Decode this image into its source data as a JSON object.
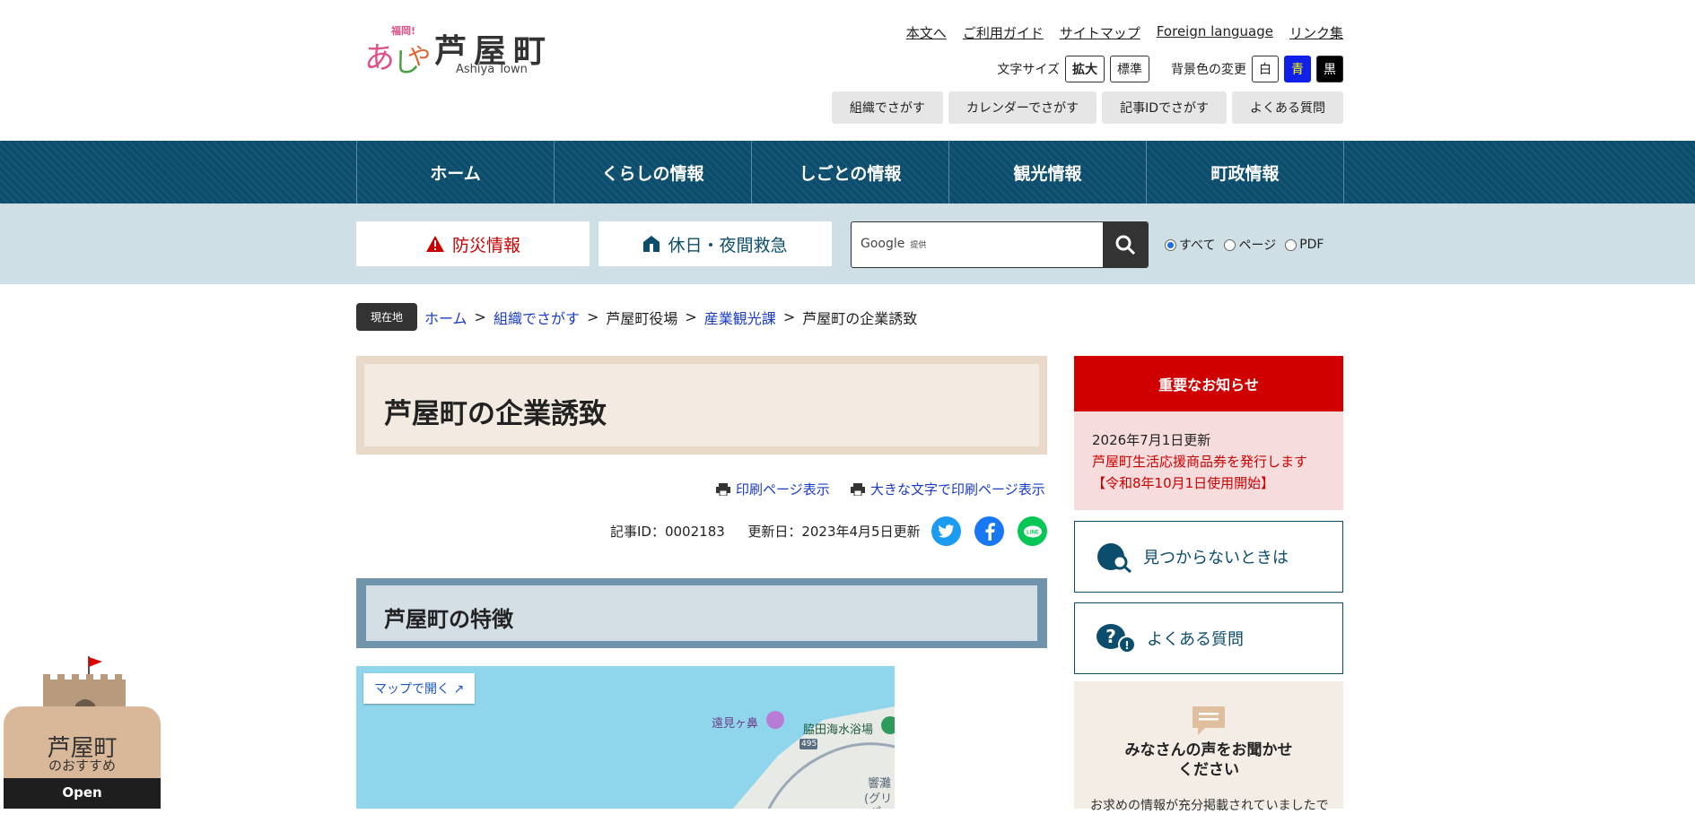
{
  "header": {
    "logo_name": "芦屋町",
    "logo_sub": "Ashiya Town",
    "logo_mark": "あしや",
    "logo_tag": "福岡!",
    "links": [
      "本文へ",
      "ご利用ガイド",
      "サイトマップ",
      "Foreign language",
      "リンク集"
    ],
    "font_size_label": "文字サイズ",
    "font_big": "拡大",
    "font_std": "標準",
    "bg_label": "背景色の変更",
    "bg_white": "白",
    "bg_blue": "青",
    "bg_black": "黒",
    "quick": [
      "組織でさがす",
      "カレンダーでさがす",
      "記事IDでさがす",
      "よくある質問"
    ]
  },
  "nav": [
    "ホーム",
    "くらしの情報",
    "しごとの情報",
    "観光情報",
    "町政情報"
  ],
  "band": {
    "disaster": "防災情報",
    "emergency": "休日・夜間救急",
    "search_brand": "Google",
    "search_provided": "提供",
    "radios": [
      "すべて",
      "ページ",
      "PDF"
    ]
  },
  "breadcrumb": {
    "here": "現在地",
    "items": [
      "ホーム",
      "組織でさがす",
      "芦屋町役場",
      "産業観光課",
      "芦屋町の企業誘致"
    ],
    "sep": ">"
  },
  "main": {
    "title": "芦屋町の企業誘致",
    "print1": "印刷ページ表示",
    "print2": "大きな文字で印刷ページ表示",
    "article_id": "記事ID：0002183",
    "updated": "更新日：2023年4月5日更新",
    "section": "芦屋町の特徴",
    "map_open": "マップで開く",
    "map_labels": [
      "遠見ヶ鼻",
      "脇田海水浴場",
      "495",
      "響灘",
      "(グリ",
      "パー"
    ]
  },
  "side": {
    "important_title": "重要なお知らせ",
    "important_date": "2026年7月1日更新",
    "important_link": "芦屋町生活応援商品券を発行します【令和8年10月1日使用開始】",
    "notfound": "見つからないときは",
    "faq": "よくある質問",
    "voice_title_1": "みなさんの声をお聞かせ",
    "voice_title_2": "ください",
    "voice_sub": "お求めの情報が充分掲載されていましたで"
  },
  "floating": {
    "title": "芦屋町",
    "sub": "のおすすめ",
    "open": "Open"
  },
  "colors": {
    "nav": "#0c4d6e",
    "important": "#d00000",
    "band": "#cfdfe6"
  }
}
